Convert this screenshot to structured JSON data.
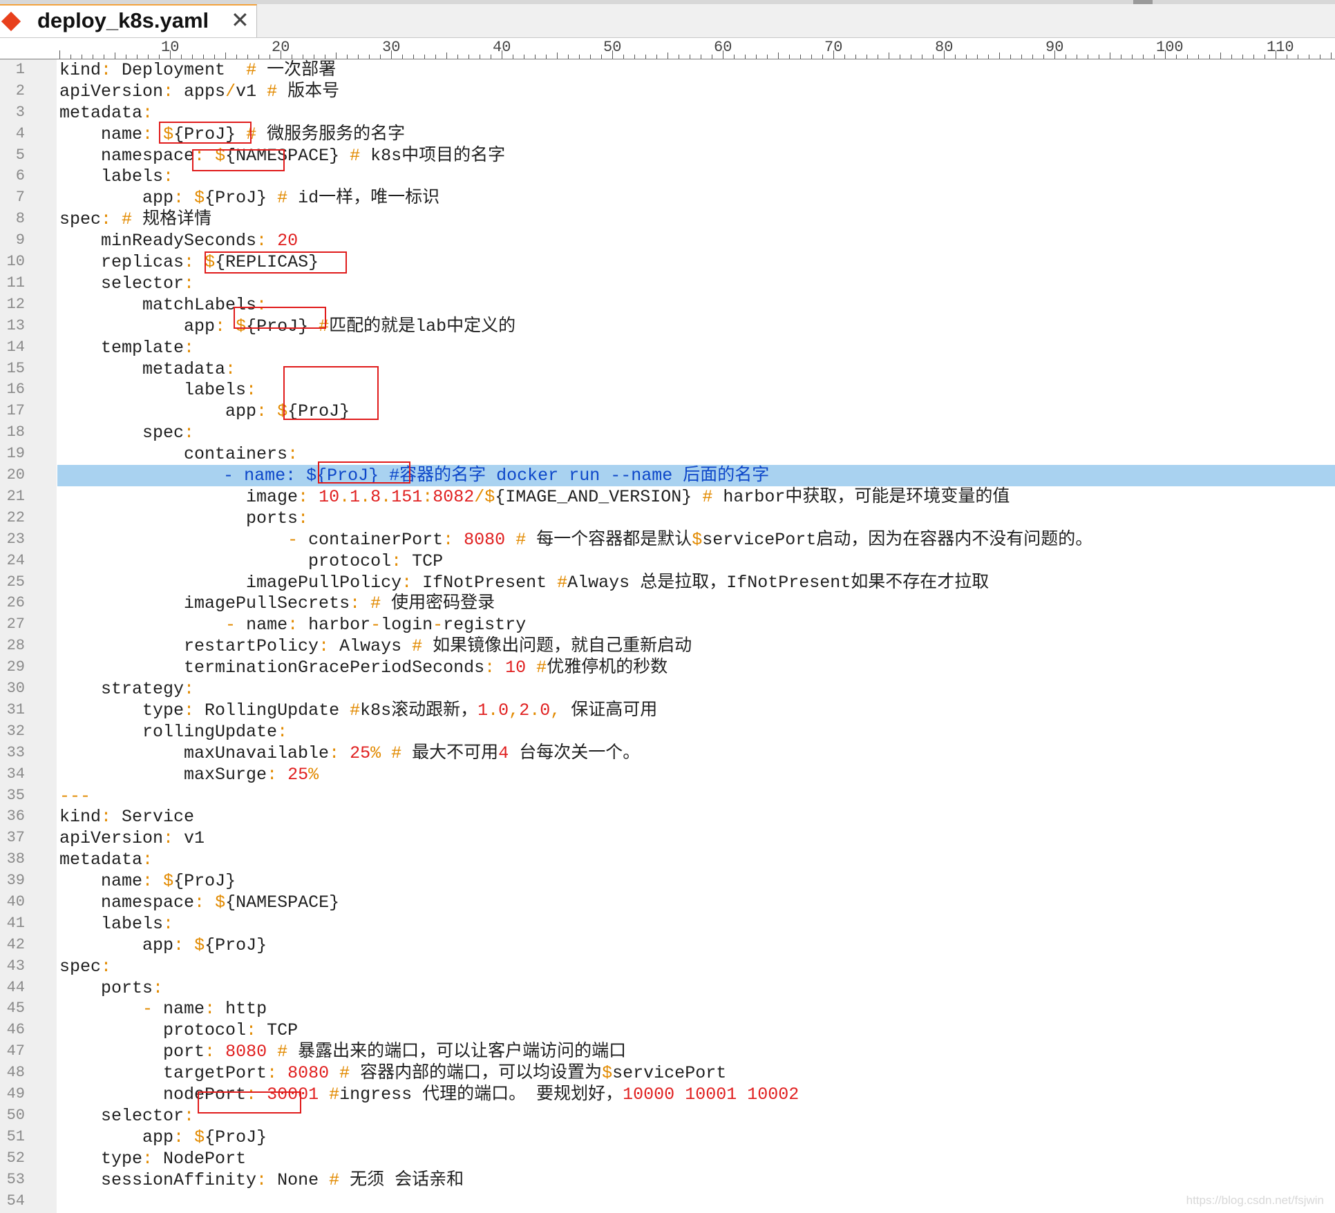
{
  "tab": {
    "title": "deploy_k8s.yaml",
    "close_glyph": "✕",
    "icon": "modified-diamond-icon"
  },
  "ruler": {
    "labels": [
      "10",
      "20",
      "30",
      "40",
      "50",
      "60",
      "70",
      "80",
      "90",
      "100",
      "110"
    ]
  },
  "editor": {
    "active_line": 20,
    "lines": [
      "kind: Deployment  # 一次部署",
      "apiVersion: apps/v1 # 版本号",
      "metadata:",
      "    name: ${ProJ} # 微服务服务的名字",
      "    namespace: ${NAMESPACE} # k8s中项目的名字",
      "    labels:",
      "        app: ${ProJ} # id一样，唯一标识",
      "spec: # 规格详情",
      "    minReadySeconds: 20",
      "    replicas: ${REPLICAS}",
      "    selector:",
      "        matchLabels:",
      "            app: ${ProJ} #匹配的就是lab中定义的",
      "    template:",
      "        metadata:",
      "            labels:",
      "                app: ${ProJ}",
      "        spec:",
      "            containers:",
      "                - name: ${ProJ} #容器的名字 docker run --name 后面的名字",
      "                  image: 10.1.8.151:8082/${IMAGE_AND_VERSION} # harbor中获取，可能是环境变量的值",
      "                  ports:",
      "                      - containerPort: 8080 # 每一个容器都是默认$servicePort启动，因为在容器内不没有问题的。",
      "                        protocol: TCP",
      "                  imagePullPolicy: IfNotPresent #Always 总是拉取，IfNotPresent如果不存在才拉取",
      "            imagePullSecrets: # 使用密码登录",
      "                - name: harbor-login-registry",
      "            restartPolicy: Always # 如果镜像出问题，就自己重新启动",
      "            terminationGracePeriodSeconds: 10 #优雅停机的秒数",
      "    strategy:",
      "        type: RollingUpdate #k8s滚动跟新，1.0,2.0, 保证高可用",
      "        rollingUpdate:",
      "            maxUnavailable: 25% # 最大不可用4 台每次关一个。",
      "            maxSurge: 25%",
      "---",
      "kind: Service",
      "apiVersion: v1",
      "metadata:",
      "    name: ${ProJ}",
      "    namespace: ${NAMESPACE}",
      "    labels:",
      "        app: ${ProJ}",
      "spec:",
      "    ports:",
      "        - name: http",
      "          protocol: TCP",
      "          port: 8080 # 暴露出来的端口，可以让客户端访问的端口",
      "          targetPort: 8080 # 容器内部的端口，可以均设置为$servicePort",
      "          nodePort: 30001 #ingress 代理的端口。 要规划好，10000 10001 10002",
      "    selector:",
      "        app: ${ProJ}",
      "    type: NodePort",
      "    sessionAffinity: None # 无须 会话亲和",
      ""
    ]
  },
  "colors": {
    "punctuation": "#e28a00",
    "number": "#e02020",
    "active_line_bg": "#a9d2f0",
    "active_line_text": "#0d47c9",
    "annotation_box": "#e01b1b",
    "gutter_bg": "#efefef"
  },
  "watermark": "https://blog.csdn.net/fsjwin"
}
